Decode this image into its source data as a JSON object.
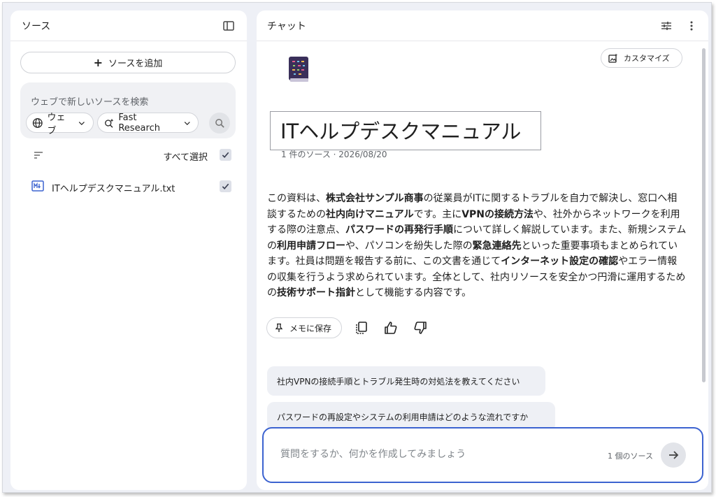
{
  "sources_panel": {
    "title": "ソース",
    "add_source_label": "ソースを追加",
    "web_search": {
      "placeholder": "ウェブで新しいソースを検索",
      "source_chip": "ウェブ",
      "mode_chip": "Fast Research"
    },
    "select_all_label": "すべて選択",
    "items": [
      {
        "name": "ITヘルプデスクマニュアル.txt",
        "checked": true
      }
    ]
  },
  "chat_panel": {
    "title": "チャット",
    "customize_label": "カスタマイズ",
    "notebook": {
      "title": "ITヘルプデスクマニュアル",
      "meta": "1 件のソース · 2026/08/20"
    },
    "summary": [
      {
        "t": "この資料は、",
        "b": false
      },
      {
        "t": "株式会社サンプル商事",
        "b": true
      },
      {
        "t": "の従業員がITに関するトラブルを自力で解決し、窓口へ相談するための",
        "b": false
      },
      {
        "t": "社内向けマニュアル",
        "b": true
      },
      {
        "t": "です。主に",
        "b": false
      },
      {
        "t": "VPNの接続方法",
        "b": true
      },
      {
        "t": "や、社外からネットワークを利用する際の注意点、",
        "b": false
      },
      {
        "t": "パスワードの再発行手順",
        "b": true
      },
      {
        "t": "について詳しく解説しています。また、新規システムの",
        "b": false
      },
      {
        "t": "利用申請フロー",
        "b": true
      },
      {
        "t": "や、パソコンを紛失した際の",
        "b": false
      },
      {
        "t": "緊急連絡先",
        "b": true
      },
      {
        "t": "といった重要事項もまとめられています。社員は問題を報告する前に、この文書を通じて",
        "b": false
      },
      {
        "t": "インターネット設定の確認",
        "b": true
      },
      {
        "t": "やエラー情報の収集を行うよう求められています。全体として、社内リソースを安全かつ円滑に運用するための",
        "b": false
      },
      {
        "t": "技術サポート指針",
        "b": true
      },
      {
        "t": "として機能する内容です。",
        "b": false
      }
    ],
    "save_memo_label": "メモに保存",
    "suggestions": [
      "社内VPNの接続手順とトラブル発生時の対処法を教えてください",
      "パスワードの再設定やシステムの利用申請はどのような流れですか"
    ],
    "input": {
      "placeholder": "質問をするか、何かを作成してみましょう",
      "value": "",
      "source_count": "1 個のソース"
    }
  },
  "icons": {
    "sidebar_toggle": "sidebar-toggle-icon",
    "web": "globe-icon",
    "research": "sparkle-search-icon",
    "search": "search-icon",
    "filter": "filter-icon",
    "file": "text-file-icon",
    "tune": "tune-icon",
    "more": "more-vert-icon",
    "customize": "customize-icon",
    "pin": "pin-icon",
    "copy": "copy-icon",
    "thumbs_up": "thumbs-up-icon",
    "thumbs_down": "thumbs-down-icon",
    "send": "arrow-right-icon"
  },
  "colors": {
    "accent_border": "#3c63d0",
    "checkbox_bg": "#dde0e8",
    "file_icon": "#3c63d0"
  }
}
